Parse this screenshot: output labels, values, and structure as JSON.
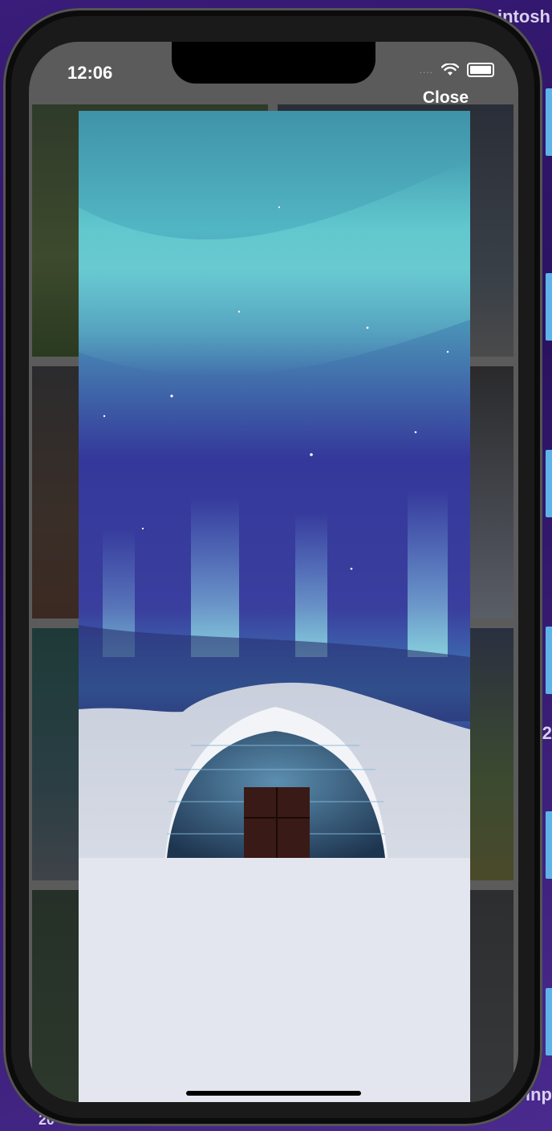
{
  "desktop": {
    "top_right_text": "intosh",
    "right_mid_text": "2",
    "bottom_right_text": "inp",
    "bottom_left_text": "20"
  },
  "status_bar": {
    "time": "12:06",
    "signal": "....",
    "wifi_icon": "wifi-icon",
    "battery_icon": "battery-icon"
  },
  "viewer": {
    "close_label": "Close",
    "image_subject": "aurora-igloo-photo"
  },
  "gallery": {
    "tiles": [
      "forest",
      "mountain-night",
      "desert-butte",
      "snowy-peak",
      "aurora",
      "waterfall",
      "woodland",
      "bridge"
    ]
  },
  "colors": {
    "sky_top": "#4fb0c0",
    "sky_mid": "#3b3f9e",
    "snow": "#dfe3ee",
    "accent_tab": "#5fb3e8"
  }
}
